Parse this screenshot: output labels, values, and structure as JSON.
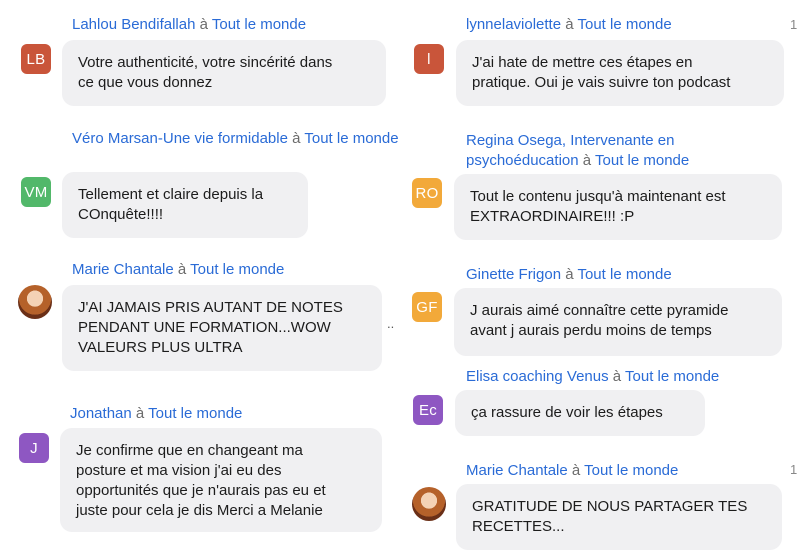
{
  "left": [
    {
      "sender": "Lahlou Bendifallah",
      "sep": "à",
      "target": "Tout le monde",
      "initials": "LB",
      "avatar_color": "#c9553a",
      "lines": [
        "Votre authenticité, votre sincérité dans",
        "ce que vous donnez"
      ]
    },
    {
      "sender": "Véro Marsan-Une vie formidable",
      "sep": "à",
      "target": "Tout le monde",
      "initials": "VM",
      "avatar_color": "#52b86a",
      "lines": [
        "Tellement et claire depuis la",
        "COnquête!!!!"
      ]
    },
    {
      "sender": "Marie Chantale",
      "sep": "à",
      "target": "Tout le monde",
      "initials": "",
      "avatar_color": "photo",
      "lines": [
        "J'AI JAMAIS PRIS AUTANT DE NOTES",
        "PENDANT UNE FORMATION...WOW",
        "VALEURS PLUS ULTRA"
      ]
    },
    {
      "sender": "Jonathan",
      "sep": "à",
      "target": "Tout le monde",
      "initials": "J",
      "avatar_color": "#8e57c2",
      "lines": [
        "Je confirme que en changeant ma",
        "posture et ma vision j'ai eu des",
        "opportunités que je n'aurais pas eu et",
        "juste pour cela je dis Merci a Melanie"
      ]
    }
  ],
  "right": [
    {
      "sender": "lynnelaviolette",
      "sep": "à",
      "target": "Tout le monde",
      "initials": "l",
      "avatar_color": "#c9553a",
      "lines": [
        "J'ai hate de mettre ces étapes en",
        "pratique. Oui je vais suivre ton podcast"
      ]
    },
    {
      "sender": "Regina Osega, Intervenante en psychoéducation",
      "sep": "à",
      "target": "Tout le monde",
      "initials": "RO",
      "avatar_color": "#f2a93a",
      "lines": [
        "Tout le contenu jusqu'à maintenant est",
        "EXTRAORDINAIRE!!! :P"
      ]
    },
    {
      "sender": "Ginette Frigon",
      "sep": "à",
      "target": "Tout le monde",
      "initials": "GF",
      "avatar_color": "#f2a93a",
      "lines": [
        "J aurais aimé connaître cette pyramide",
        "avant j aurais perdu moins de temps"
      ]
    },
    {
      "sender": "Elisa coaching Venus",
      "sep": "à",
      "target": "Tout le monde",
      "initials": "Ec",
      "avatar_color": "#8e57c2",
      "lines": [
        "ça rassure de voir les étapes"
      ]
    },
    {
      "sender": "Marie Chantale",
      "sep": "à",
      "target": "Tout le monde",
      "initials": "",
      "avatar_color": "photo",
      "lines": [
        "GRATITUDE DE NOUS PARTAGER TES",
        "RECETTES..."
      ]
    }
  ],
  "marks": {
    "dots": "..",
    "one_a": "1",
    "one_b": "1"
  }
}
